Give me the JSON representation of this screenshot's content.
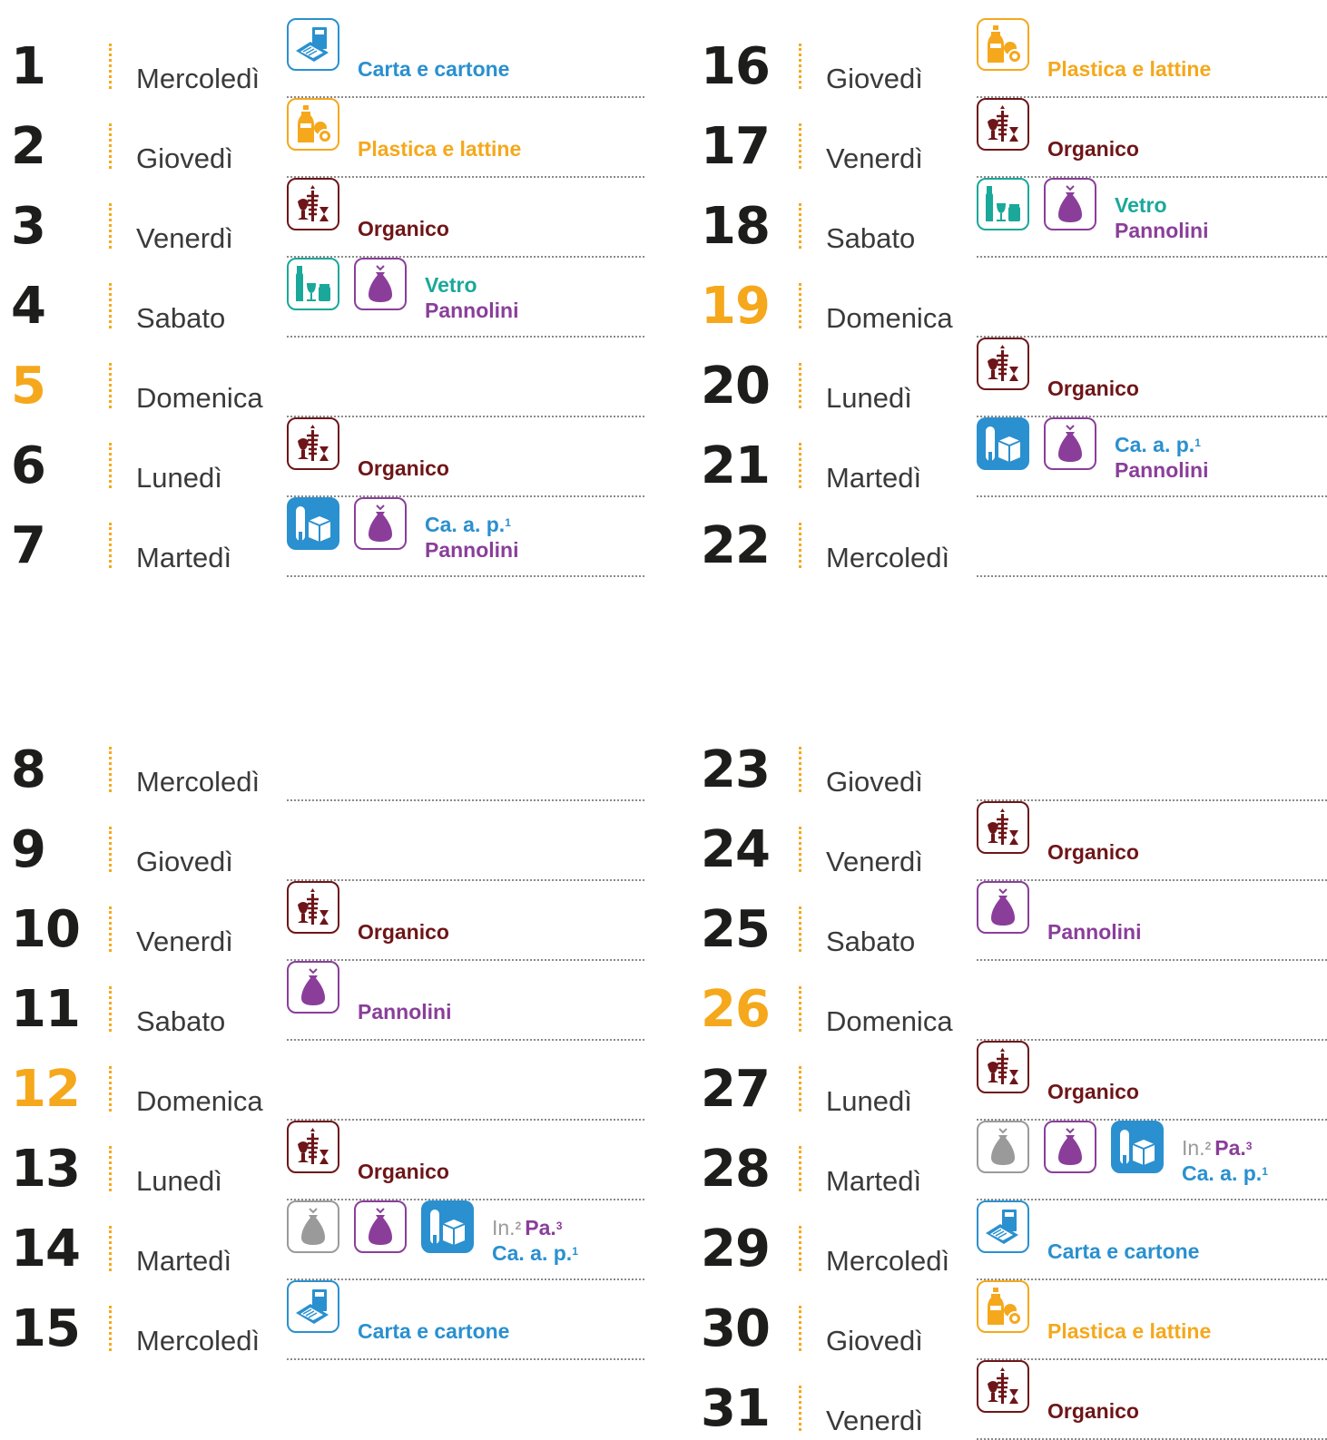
{
  "days": [
    {
      "num": "1",
      "day": "Mercoledì",
      "sunday": false,
      "icons": [
        "carta"
      ],
      "labels": [
        [
          "Carta e cartone"
        ]
      ]
    },
    {
      "num": "2",
      "day": "Giovedì",
      "sunday": false,
      "icons": [
        "plastica"
      ],
      "labels": [
        [
          "Plastica e lattine"
        ]
      ]
    },
    {
      "num": "3",
      "day": "Venerdì",
      "sunday": false,
      "icons": [
        "organico"
      ],
      "labels": [
        [
          "Organico"
        ]
      ]
    },
    {
      "num": "4",
      "day": "Sabato",
      "sunday": false,
      "icons": [
        "vetro",
        "pannolini"
      ],
      "labels": [
        [
          "Vetro"
        ],
        [
          "Pannolini"
        ]
      ]
    },
    {
      "num": "5",
      "day": "Domenica",
      "sunday": true,
      "icons": [],
      "labels": []
    },
    {
      "num": "6",
      "day": "Lunedì",
      "sunday": false,
      "icons": [
        "organico"
      ],
      "labels": [
        [
          "Organico"
        ]
      ]
    },
    {
      "num": "7",
      "day": "Martedì",
      "sunday": false,
      "icons": [
        "cap",
        "pannolini"
      ],
      "labels": [
        [
          "Ca. a. p.",
          "1"
        ],
        [
          "Pannolini"
        ]
      ]
    },
    {
      "num": "8",
      "day": "Mercoledì",
      "sunday": false,
      "icons": [],
      "labels": []
    },
    {
      "num": "9",
      "day": "Giovedì",
      "sunday": false,
      "icons": [],
      "labels": []
    },
    {
      "num": "10",
      "day": "Venerdì",
      "sunday": false,
      "icons": [
        "organico"
      ],
      "labels": [
        [
          "Organico"
        ]
      ]
    },
    {
      "num": "11",
      "day": "Sabato",
      "sunday": false,
      "icons": [
        "pannolini"
      ],
      "labels": [
        [
          "Pannolini"
        ]
      ]
    },
    {
      "num": "12",
      "day": "Domenica",
      "sunday": true,
      "icons": [],
      "labels": []
    },
    {
      "num": "13",
      "day": "Lunedì",
      "sunday": false,
      "icons": [
        "organico"
      ],
      "labels": [
        [
          "Organico"
        ]
      ]
    },
    {
      "num": "14",
      "day": "Martedì",
      "sunday": false,
      "icons": [
        "indiff",
        "pannolini",
        "cap"
      ],
      "labels": [
        [
          "In.",
          "2",
          "Pa.",
          "3"
        ],
        [
          "Ca. a. p.",
          "1"
        ]
      ]
    },
    {
      "num": "15",
      "day": "Mercoledì",
      "sunday": false,
      "icons": [
        "carta"
      ],
      "labels": [
        [
          "Carta e cartone"
        ]
      ]
    },
    {
      "num": "16",
      "day": "Giovedì",
      "sunday": false,
      "icons": [
        "plastica"
      ],
      "labels": [
        [
          "Plastica e lattine"
        ]
      ]
    },
    {
      "num": "17",
      "day": "Venerdì",
      "sunday": false,
      "icons": [
        "organico"
      ],
      "labels": [
        [
          "Organico"
        ]
      ]
    },
    {
      "num": "18",
      "day": "Sabato",
      "sunday": false,
      "icons": [
        "vetro",
        "pannolini"
      ],
      "labels": [
        [
          "Vetro"
        ],
        [
          "Pannolini"
        ]
      ]
    },
    {
      "num": "19",
      "day": "Domenica",
      "sunday": true,
      "icons": [],
      "labels": []
    },
    {
      "num": "20",
      "day": "Lunedì",
      "sunday": false,
      "icons": [
        "organico"
      ],
      "labels": [
        [
          "Organico"
        ]
      ]
    },
    {
      "num": "21",
      "day": "Martedì",
      "sunday": false,
      "icons": [
        "cap",
        "pannolini"
      ],
      "labels": [
        [
          "Ca. a. p.",
          "1"
        ],
        [
          "Pannolini"
        ]
      ]
    },
    {
      "num": "22",
      "day": "Mercoledì",
      "sunday": false,
      "icons": [],
      "labels": []
    },
    {
      "num": "23",
      "day": "Giovedì",
      "sunday": false,
      "icons": [],
      "labels": []
    },
    {
      "num": "24",
      "day": "Venerdì",
      "sunday": false,
      "icons": [
        "organico"
      ],
      "labels": [
        [
          "Organico"
        ]
      ]
    },
    {
      "num": "25",
      "day": "Sabato",
      "sunday": false,
      "icons": [
        "pannolini"
      ],
      "labels": [
        [
          "Pannolini"
        ]
      ]
    },
    {
      "num": "26",
      "day": "Domenica",
      "sunday": true,
      "icons": [],
      "labels": []
    },
    {
      "num": "27",
      "day": "Lunedì",
      "sunday": false,
      "icons": [
        "organico"
      ],
      "labels": [
        [
          "Organico"
        ]
      ]
    },
    {
      "num": "28",
      "day": "Martedì",
      "sunday": false,
      "icons": [
        "indiff",
        "pannolini",
        "cap"
      ],
      "labels": [
        [
          "In.",
          "2",
          "Pa.",
          "3"
        ],
        [
          "Ca. a. p.",
          "1"
        ]
      ]
    },
    {
      "num": "29",
      "day": "Mercoledì",
      "sunday": false,
      "icons": [
        "carta"
      ],
      "labels": [
        [
          "Carta e cartone"
        ]
      ]
    },
    {
      "num": "30",
      "day": "Giovedì",
      "sunday": false,
      "icons": [
        "plastica"
      ],
      "labels": [
        [
          "Plastica e lattine"
        ]
      ]
    },
    {
      "num": "31",
      "day": "Venerdì",
      "sunday": false,
      "icons": [
        "organico"
      ],
      "labels": [
        [
          "Organico"
        ]
      ]
    }
  ],
  "colors": {
    "sunday": "#f5a81c",
    "carta": "#2a90cf",
    "plastica": "#f5a81c",
    "organico": "#6e1518",
    "vetro": "#1aa89a",
    "pannolini": "#8a3e9a",
    "indiff": "#9a9a9a",
    "cap": "#2a90cf"
  }
}
